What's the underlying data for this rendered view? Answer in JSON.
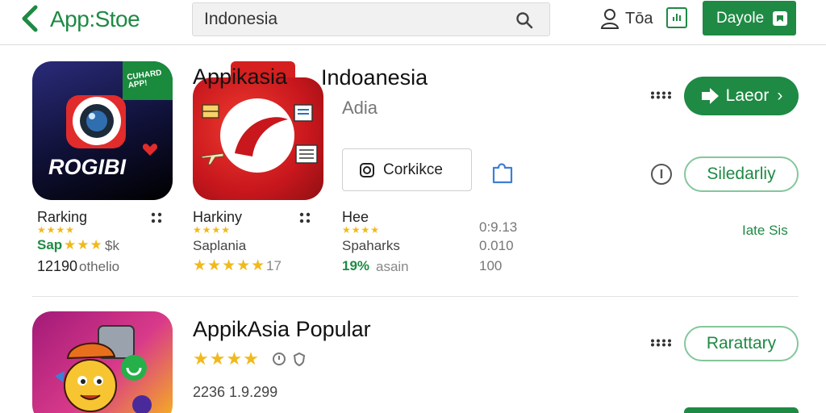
{
  "header": {
    "brand": "App:Stoe",
    "search_value": "Indonesia",
    "user_label": "Tōa",
    "cta_label": "Dayole"
  },
  "featured": {
    "title_overlap": "Appikasia",
    "title": "Indoanesia",
    "subtitle": "Adia",
    "action_button": "Corkikce",
    "primary_button": "Laeor",
    "secondary_button": "Siledarliy"
  },
  "apps": [
    {
      "badge_text": "CUHARD APP!",
      "icon_text": "ROGIBI",
      "name": "Rarking",
      "rating_line": "Sap",
      "rating_suffix": "$k",
      "count": "12190",
      "count_suffix": "othelio"
    },
    {
      "name": "Harkiny",
      "sub": "Saplania",
      "count": "17"
    },
    {
      "name": "Hee",
      "stat_label": "Spaharks",
      "stat_value": "19%",
      "stat_suffix": "asain"
    }
  ],
  "stats_column": [
    "0:9.13",
    "0.010",
    "100"
  ],
  "side_link": "Iate Sis",
  "second_app": {
    "title": "AppikAsia Popular",
    "meta": "2236 1.9.299",
    "button": "Rarattary"
  },
  "colors": {
    "accent": "#1e8a44",
    "star": "#f1b91a"
  }
}
